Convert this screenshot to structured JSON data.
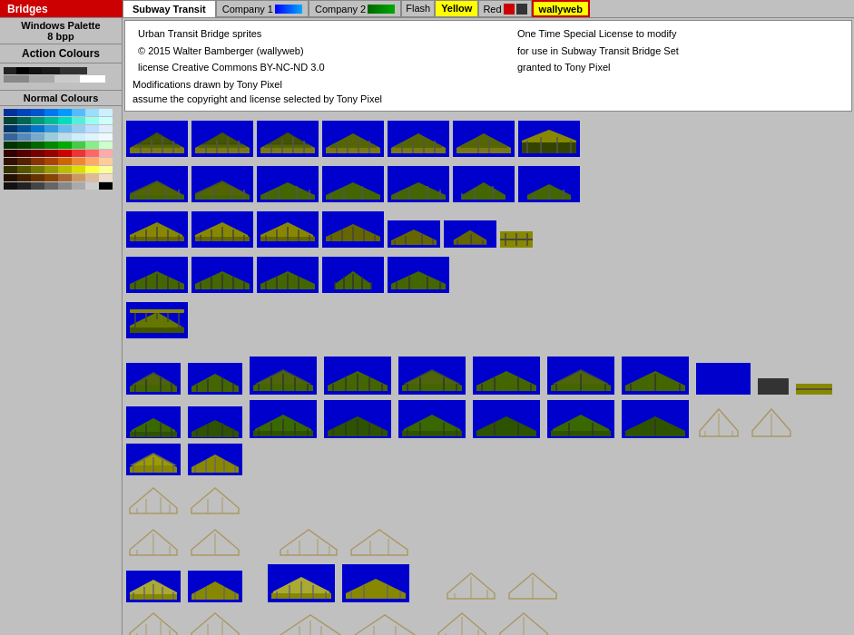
{
  "topbar": {
    "title": "Bridges",
    "tabs": [
      {
        "label": "Subway Transit",
        "active": true
      },
      {
        "label": "Company 1",
        "active": false
      },
      {
        "label": "Company 2",
        "active": false
      },
      {
        "label": "Flash",
        "active": false
      },
      {
        "label": "Yellow",
        "active": false
      },
      {
        "label": "Red",
        "active": false
      },
      {
        "label": "wallyweb",
        "active": false
      }
    ]
  },
  "sidebar": {
    "title": "Windows Palette",
    "subtitle": "8 bpp",
    "action_colours": "Action Colours",
    "normal_colours": "Normal Colours"
  },
  "info": {
    "line1a": "Urban Transit Bridge sprites",
    "line1b": "One Time Special License to modify",
    "line2a": "© 2015 Walter Bamberger (wallyweb)",
    "line2b": "for use in Subway Transit Bridge Set",
    "line3a": "license Creative Commons BY-NC-ND 3.0",
    "line3b": "granted to Tony Pixel",
    "line4": "Modifications drawn by Tony Pixel",
    "line5": "assume the copyright and license selected by Tony Pixel"
  }
}
